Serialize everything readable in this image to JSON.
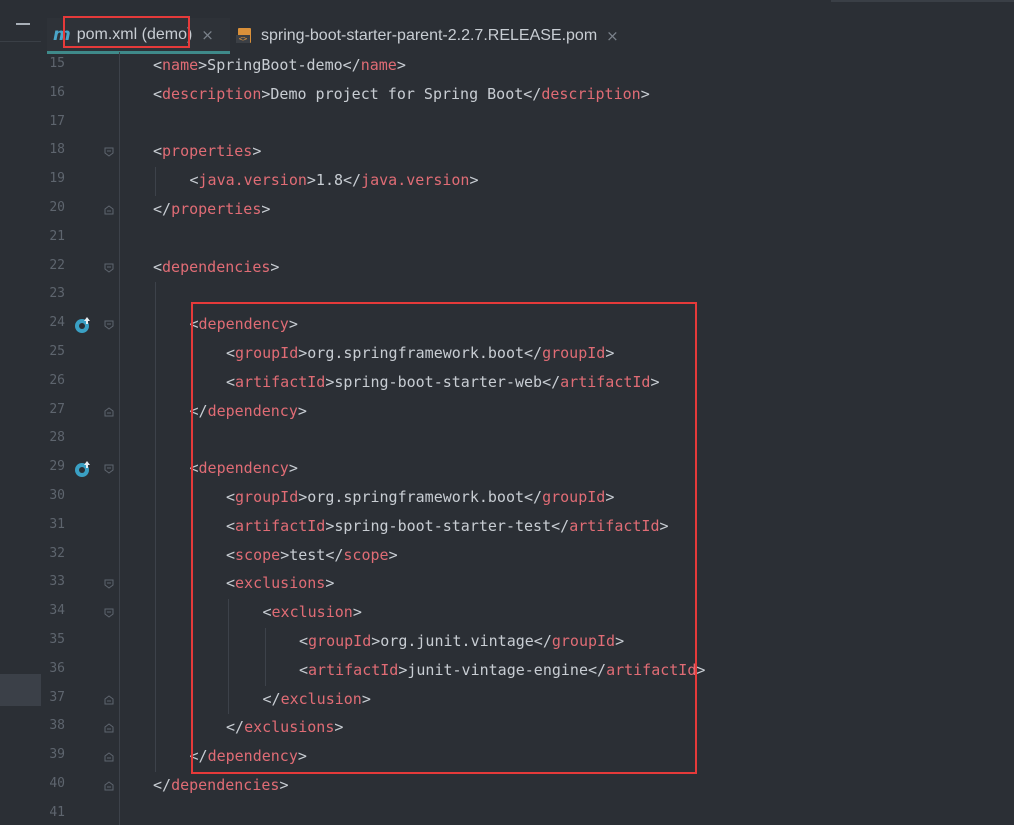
{
  "tabs": [
    {
      "label": "pom.xml (demo)",
      "icon": "maven-icon",
      "active": true
    },
    {
      "label": "spring-boot-starter-parent-2.2.7.RELEASE.pom",
      "icon": "pom-file-icon",
      "active": false
    }
  ],
  "close_glyph": "×",
  "lines": [
    {
      "num": "15",
      "indent": 1,
      "tokens": [
        {
          "t": "<",
          "c": "bracket"
        },
        {
          "t": "name",
          "c": "tag"
        },
        {
          "t": ">SpringBoot-demo</",
          "c": "bracket"
        },
        {
          "t": "name",
          "c": "tag"
        },
        {
          "t": ">",
          "c": "bracket"
        }
      ]
    },
    {
      "num": "16",
      "indent": 1,
      "tokens": [
        {
          "t": "<",
          "c": "bracket"
        },
        {
          "t": "description",
          "c": "tag"
        },
        {
          "t": ">Demo project for Spring Boot</",
          "c": "bracket"
        },
        {
          "t": "description",
          "c": "tag"
        },
        {
          "t": ">",
          "c": "bracket"
        }
      ]
    },
    {
      "num": "17",
      "indent": 0,
      "tokens": []
    },
    {
      "num": "18",
      "indent": 1,
      "fold": "open",
      "tokens": [
        {
          "t": "<",
          "c": "bracket"
        },
        {
          "t": "properties",
          "c": "tag"
        },
        {
          "t": ">",
          "c": "bracket"
        }
      ]
    },
    {
      "num": "19",
      "indent": 2,
      "tokens": [
        {
          "t": "<",
          "c": "bracket"
        },
        {
          "t": "java.version",
          "c": "tag"
        },
        {
          "t": ">1.8</",
          "c": "bracket"
        },
        {
          "t": "java.version",
          "c": "tag"
        },
        {
          "t": ">",
          "c": "bracket"
        }
      ]
    },
    {
      "num": "20",
      "indent": 1,
      "fold": "close",
      "tokens": [
        {
          "t": "</",
          "c": "bracket"
        },
        {
          "t": "properties",
          "c": "tag"
        },
        {
          "t": ">",
          "c": "bracket"
        }
      ]
    },
    {
      "num": "21",
      "indent": 0,
      "tokens": []
    },
    {
      "num": "22",
      "indent": 1,
      "fold": "open",
      "tokens": [
        {
          "t": "<",
          "c": "bracket"
        },
        {
          "t": "dependencies",
          "c": "tag"
        },
        {
          "t": ">",
          "c": "bracket"
        }
      ]
    },
    {
      "num": "23",
      "indent": 0,
      "tokens": []
    },
    {
      "num": "24",
      "indent": 2,
      "fold": "open",
      "gutter_icon": "overridden-up-icon",
      "tokens": [
        {
          "t": "<",
          "c": "bracket"
        },
        {
          "t": "dependency",
          "c": "tag"
        },
        {
          "t": ">",
          "c": "bracket"
        }
      ]
    },
    {
      "num": "25",
      "indent": 3,
      "tokens": [
        {
          "t": "<",
          "c": "bracket"
        },
        {
          "t": "groupId",
          "c": "tag"
        },
        {
          "t": ">org.springframework.boot</",
          "c": "bracket"
        },
        {
          "t": "groupId",
          "c": "tag"
        },
        {
          "t": ">",
          "c": "bracket"
        }
      ]
    },
    {
      "num": "26",
      "indent": 3,
      "tokens": [
        {
          "t": "<",
          "c": "bracket"
        },
        {
          "t": "artifactId",
          "c": "tag"
        },
        {
          "t": ">spring-boot-starter-web</",
          "c": "bracket"
        },
        {
          "t": "artifactId",
          "c": "tag"
        },
        {
          "t": ">",
          "c": "bracket"
        }
      ]
    },
    {
      "num": "27",
      "indent": 2,
      "fold": "close",
      "tokens": [
        {
          "t": "</",
          "c": "bracket"
        },
        {
          "t": "dependency",
          "c": "tag"
        },
        {
          "t": ">",
          "c": "bracket"
        }
      ]
    },
    {
      "num": "28",
      "indent": 0,
      "tokens": []
    },
    {
      "num": "29",
      "indent": 2,
      "fold": "open",
      "gutter_icon": "overridden-up-icon",
      "tokens": [
        {
          "t": "<",
          "c": "bracket"
        },
        {
          "t": "dependency",
          "c": "tag"
        },
        {
          "t": ">",
          "c": "bracket"
        }
      ]
    },
    {
      "num": "30",
      "indent": 3,
      "tokens": [
        {
          "t": "<",
          "c": "bracket"
        },
        {
          "t": "groupId",
          "c": "tag"
        },
        {
          "t": ">org.springframework.boot</",
          "c": "bracket"
        },
        {
          "t": "groupId",
          "c": "tag"
        },
        {
          "t": ">",
          "c": "bracket"
        }
      ]
    },
    {
      "num": "31",
      "indent": 3,
      "tokens": [
        {
          "t": "<",
          "c": "bracket"
        },
        {
          "t": "artifactId",
          "c": "tag"
        },
        {
          "t": ">spring-boot-starter-test</",
          "c": "bracket"
        },
        {
          "t": "artifactId",
          "c": "tag"
        },
        {
          "t": ">",
          "c": "bracket"
        }
      ]
    },
    {
      "num": "32",
      "indent": 3,
      "tokens": [
        {
          "t": "<",
          "c": "bracket"
        },
        {
          "t": "scope",
          "c": "tag"
        },
        {
          "t": ">test</",
          "c": "bracket"
        },
        {
          "t": "scope",
          "c": "tag"
        },
        {
          "t": ">",
          "c": "bracket"
        }
      ]
    },
    {
      "num": "33",
      "indent": 3,
      "fold": "open",
      "tokens": [
        {
          "t": "<",
          "c": "bracket"
        },
        {
          "t": "exclusions",
          "c": "tag"
        },
        {
          "t": ">",
          "c": "bracket"
        }
      ]
    },
    {
      "num": "34",
      "indent": 4,
      "fold": "open",
      "tokens": [
        {
          "t": "<",
          "c": "bracket"
        },
        {
          "t": "exclusion",
          "c": "tag"
        },
        {
          "t": ">",
          "c": "bracket"
        }
      ]
    },
    {
      "num": "35",
      "indent": 5,
      "tokens": [
        {
          "t": "<",
          "c": "bracket"
        },
        {
          "t": "groupId",
          "c": "tag"
        },
        {
          "t": ">org.junit.vintage</",
          "c": "bracket"
        },
        {
          "t": "groupId",
          "c": "tag"
        },
        {
          "t": ">",
          "c": "bracket"
        }
      ]
    },
    {
      "num": "36",
      "indent": 5,
      "tokens": [
        {
          "t": "<",
          "c": "bracket"
        },
        {
          "t": "artifactId",
          "c": "tag"
        },
        {
          "t": ">junit-vintage-engine</",
          "c": "bracket"
        },
        {
          "t": "artifactId",
          "c": "tag"
        },
        {
          "t": ">",
          "c": "bracket"
        }
      ]
    },
    {
      "num": "37",
      "indent": 4,
      "fold": "close",
      "tokens": [
        {
          "t": "</",
          "c": "bracket"
        },
        {
          "t": "exclusion",
          "c": "tag"
        },
        {
          "t": ">",
          "c": "bracket"
        }
      ]
    },
    {
      "num": "38",
      "indent": 3,
      "fold": "close",
      "tokens": [
        {
          "t": "</",
          "c": "bracket"
        },
        {
          "t": "exclusions",
          "c": "tag"
        },
        {
          "t": ">",
          "c": "bracket"
        }
      ]
    },
    {
      "num": "39",
      "indent": 2,
      "fold": "close",
      "tokens": [
        {
          "t": "</",
          "c": "bracket"
        },
        {
          "t": "dependency",
          "c": "tag"
        },
        {
          "t": ">",
          "c": "bracket"
        }
      ]
    },
    {
      "num": "40",
      "indent": 1,
      "fold": "close",
      "tokens": [
        {
          "t": "</",
          "c": "bracket"
        },
        {
          "t": "dependencies",
          "c": "tag"
        },
        {
          "t": ">",
          "c": "bracket"
        }
      ]
    },
    {
      "num": "41",
      "indent": 0,
      "tokens": []
    }
  ],
  "colors": {
    "tag": "#e06c75",
    "text": "#c8cdd3",
    "highlight_box": "#e53a3a",
    "line_number": "#5e656e",
    "maven_icon": "#4aa5c8"
  }
}
